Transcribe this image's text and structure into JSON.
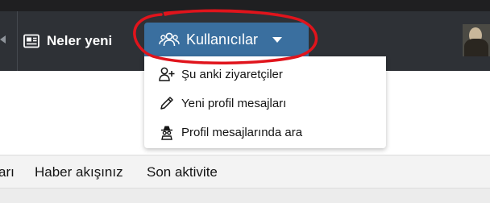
{
  "navbar": {
    "whats_new_label": "Neler yeni",
    "users_label": "Kullanıcılar"
  },
  "users_menu": {
    "items": [
      {
        "label": "Şu anki ziyaretçiler",
        "icon": "user-plus-icon"
      },
      {
        "label": "Yeni profil mesajları",
        "icon": "pencil-icon"
      },
      {
        "label": "Profil mesajlarında ara",
        "icon": "spy-icon"
      }
    ]
  },
  "subnav": {
    "items": [
      "arı",
      "Haber akışınız",
      "Son aktivite"
    ]
  },
  "colors": {
    "navbar_bg": "#2e3136",
    "users_tab_bg": "#3a6f9f",
    "annotation_red": "#e0141c"
  }
}
